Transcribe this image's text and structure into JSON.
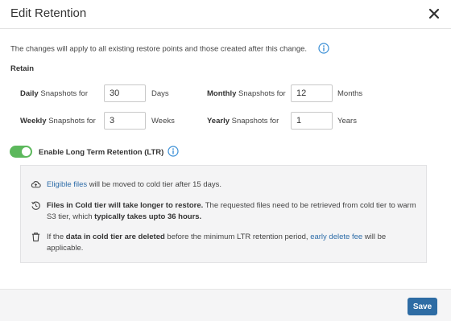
{
  "header": {
    "title": "Edit Retention",
    "close_icon": "close-icon"
  },
  "description": "The changes will apply to all existing restore points and those created after this change.",
  "retain_label": "Retain",
  "fields": {
    "daily": {
      "label_bold": "Daily",
      "label_rest": " Snapshots for",
      "value": "30",
      "unit": "Days"
    },
    "weekly": {
      "label_bold": "Weekly",
      "label_rest": " Snapshots for",
      "value": "3",
      "unit": "Weeks"
    },
    "monthly": {
      "label_bold": "Monthly",
      "label_rest": " Snapshots for",
      "value": "12",
      "unit": "Months"
    },
    "yearly": {
      "label_bold": "Yearly",
      "label_rest": " Snapshots for",
      "value": "1",
      "unit": "Years"
    }
  },
  "ltr": {
    "toggle_on": true,
    "label": "Enable Long Term Retention (LTR)",
    "row1": {
      "link": "Eligible files",
      "text": " will be moved to cold tier after 15 days."
    },
    "row2": {
      "bold1": "Files in Cold tier will take longer to restore.",
      "text1": " The requested files need to be retrieved from cold tier to warm S3 tier, which ",
      "bold2": "typically takes upto 36 hours."
    },
    "row3": {
      "text1": "If the ",
      "bold1": "data in cold tier are deleted",
      "text2": " before the minimum LTR retention period, ",
      "link": "early delete fee",
      "text3": " will be applicable."
    }
  },
  "footer": {
    "save_label": "Save"
  },
  "colors": {
    "accent": "#2e6ca4",
    "toggle_on": "#5cb85c",
    "link": "#2d6ca8",
    "info_icon": "#3a8fd6"
  }
}
